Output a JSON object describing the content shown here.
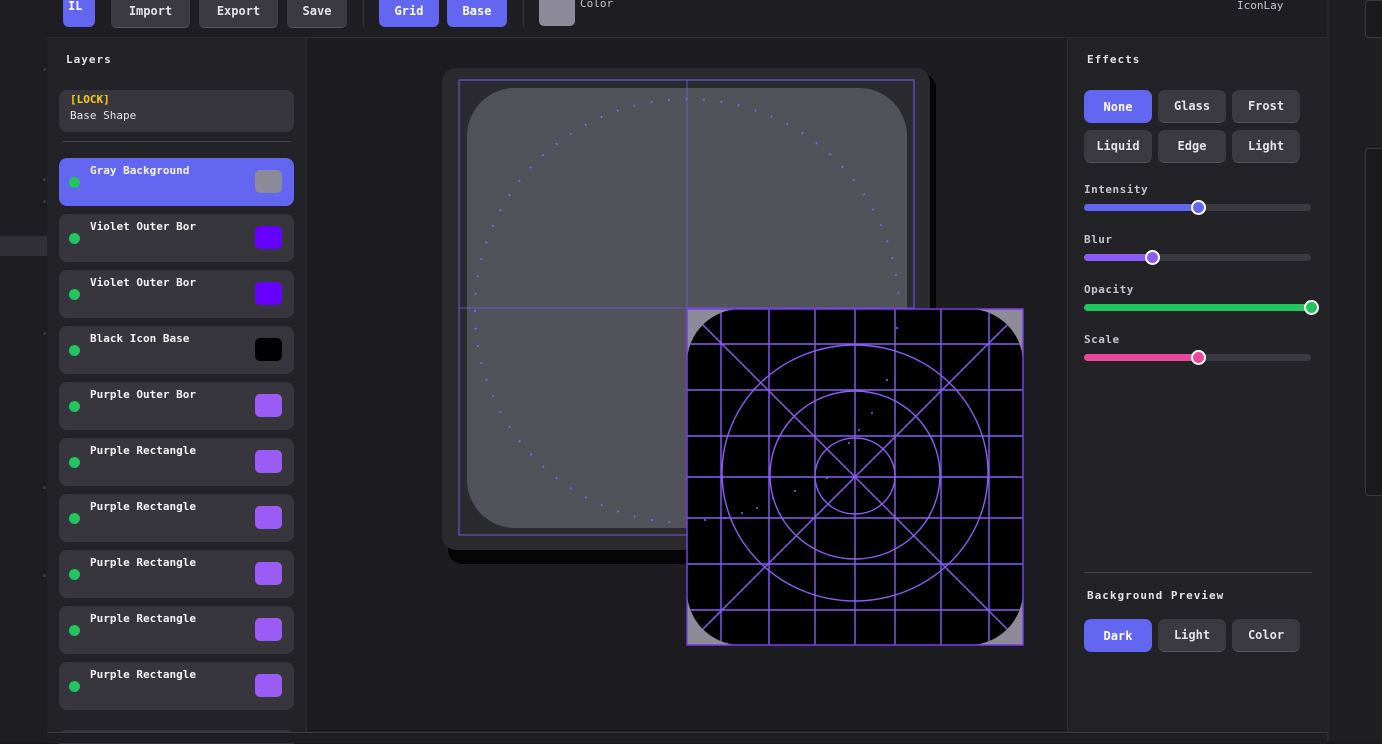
{
  "toolbar": {
    "logo": "IL",
    "buttons": [
      "Import",
      "Export",
      "Save"
    ],
    "toggles": [
      "Grid",
      "Base"
    ],
    "color_label": "Color",
    "color_swatch": "#8d8b99",
    "app_name": "IconLay"
  },
  "layers_panel": {
    "title": "Layers",
    "locked_layer": {
      "tag": "[LOCK]",
      "name": "Base Shape"
    },
    "layers": [
      {
        "name": "Gray Background",
        "color": "#8d8b99",
        "selected": true
      },
      {
        "name": "Violet Outer Bor",
        "color": "#6600ff",
        "selected": false
      },
      {
        "name": "Violet Outer Bor",
        "color": "#6600ff",
        "selected": false
      },
      {
        "name": "Black Icon Base",
        "color": "#000000",
        "selected": false
      },
      {
        "name": "Purple Outer Bor",
        "color": "#9b5cf6",
        "selected": false
      },
      {
        "name": "Purple Rectangle",
        "color": "#9b5cf6",
        "selected": false
      },
      {
        "name": "Purple Rectangle",
        "color": "#9b5cf6",
        "selected": false
      },
      {
        "name": "Purple Rectangle",
        "color": "#9b5cf6",
        "selected": false
      },
      {
        "name": "Purple Rectangle",
        "color": "#9b5cf6",
        "selected": false
      },
      {
        "name": "Purple Rectangle",
        "color": "#9b5cf6",
        "selected": false
      }
    ]
  },
  "effects_panel": {
    "title": "Effects",
    "effects": [
      "None",
      "Glass",
      "Frost",
      "Liquid",
      "Edge",
      "Light"
    ],
    "active_effect": "None",
    "sliders": [
      {
        "label": "Intensity",
        "value": 0.5,
        "color": "#6366f1"
      },
      {
        "label": "Blur",
        "value": 0.3,
        "color": "#8b5cf6"
      },
      {
        "label": "Opacity",
        "value": 1.0,
        "color": "#22c55e"
      },
      {
        "label": "Scale",
        "value": 0.5,
        "color": "#ec4899"
      }
    ]
  },
  "background_preview": {
    "title": "Background Preview",
    "options": [
      "Dark",
      "Light",
      "Color"
    ],
    "active": "Dark"
  },
  "colors": {
    "accent": "#6366f1",
    "lock": "#facc15",
    "visible": "#22c55e",
    "grid": "#8b5cf6"
  }
}
